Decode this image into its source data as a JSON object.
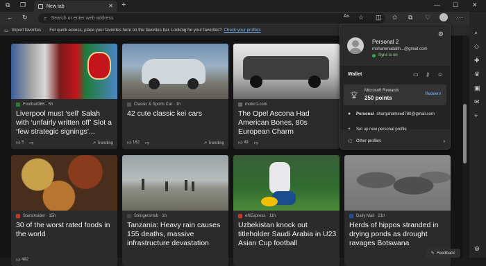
{
  "tabs": [
    {
      "label": "New tab"
    }
  ],
  "address_bar": {
    "placeholder": "Search or enter web address"
  },
  "favorites_bar": {
    "import_label": "Import favorites",
    "message": "For quick access, place your favorites here on the favorites bar. Looking for your favorites?",
    "link": "Check your profiles"
  },
  "profile_panel": {
    "name": "Personal 2",
    "email": "mohammadalih...@gmail.com",
    "sync_status": "Sync is on",
    "wallet_title": "Wallet",
    "rewards_label": "Microsoft Rewards",
    "rewards_points": "250 points",
    "redeem_label": "Redeem",
    "other_profile_tag": "Personal",
    "other_profile_email": "sharqahameed780@gmail.com",
    "setup_label": "Set up new personal profile",
    "other_profiles_label": "Other profiles"
  },
  "cards": [
    {
      "source": "Football365 · 5h",
      "title": "Liverpool must ‘sell’ Salah with ‘unfairly written off’ Slot a ‘few strategic signings’...",
      "likes": "5",
      "trend": "Trending",
      "src_color": "#2f7d32"
    },
    {
      "source": "Classic & Sports Car · 1h",
      "title": "42 cute classic kei cars",
      "likes": "162",
      "trend": "Trending",
      "src_color": "#555555"
    },
    {
      "source": "motor1.com",
      "title": "The Opel Ascona Had American Bones, 80s European Charm",
      "likes": "49",
      "trend": "",
      "src_color": "#666666"
    },
    {
      "source": "StarsInsider · 15h",
      "title": "30 of the worst rated foods in the world",
      "likes": "482",
      "trend": "",
      "src_color": "#c0392b"
    },
    {
      "source": "StringersHub · 1h",
      "title": "Tanzania: Heavy rain causes 155 deaths, massive infrastructure devastation",
      "likes": "",
      "trend": "",
      "src_color": "#444444"
    },
    {
      "source": "eNExpress · 11h",
      "title": "Uzbekistan knock out titleholder Saudi Arabia in U23 Asian Cup football",
      "likes": "",
      "trend": "",
      "src_color": "#c0392b"
    },
    {
      "source": "Daily Mail · 21h",
      "title": "Herds of hippos stranded in drying ponds as drought ravages Botswana",
      "likes": "",
      "trend": "",
      "src_color": "#2a4d8f"
    }
  ],
  "feedback_label": "Feedback"
}
